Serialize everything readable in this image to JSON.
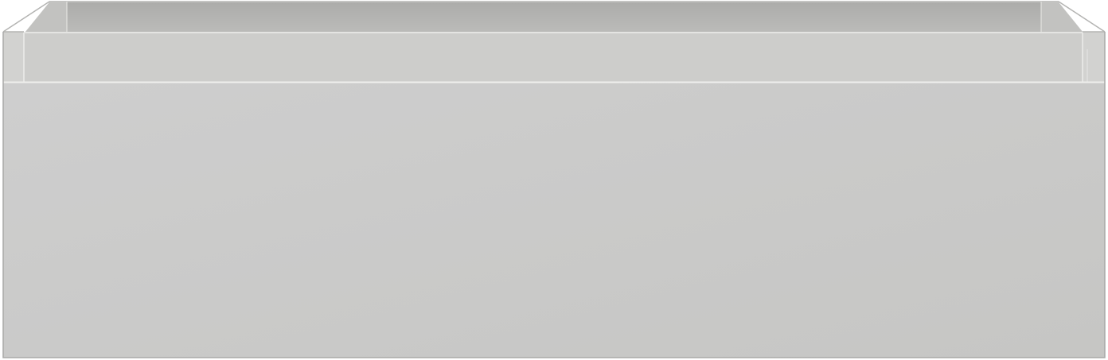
{
  "object": {
    "icon": "drawer-box-icon",
    "colors": {
      "front_panel": "#cbcbc9",
      "front_panel_shadow": "#c6c6c4",
      "inner_back_wall": "#b9b9b7",
      "inner_back_wall_top": "#adadab",
      "rim_top": "#d3d3d1",
      "side_wall": "#c3c3c1",
      "edge_highlight": "#ececea",
      "edge_line": "#a9a9a7",
      "background": "#ffffff"
    }
  }
}
